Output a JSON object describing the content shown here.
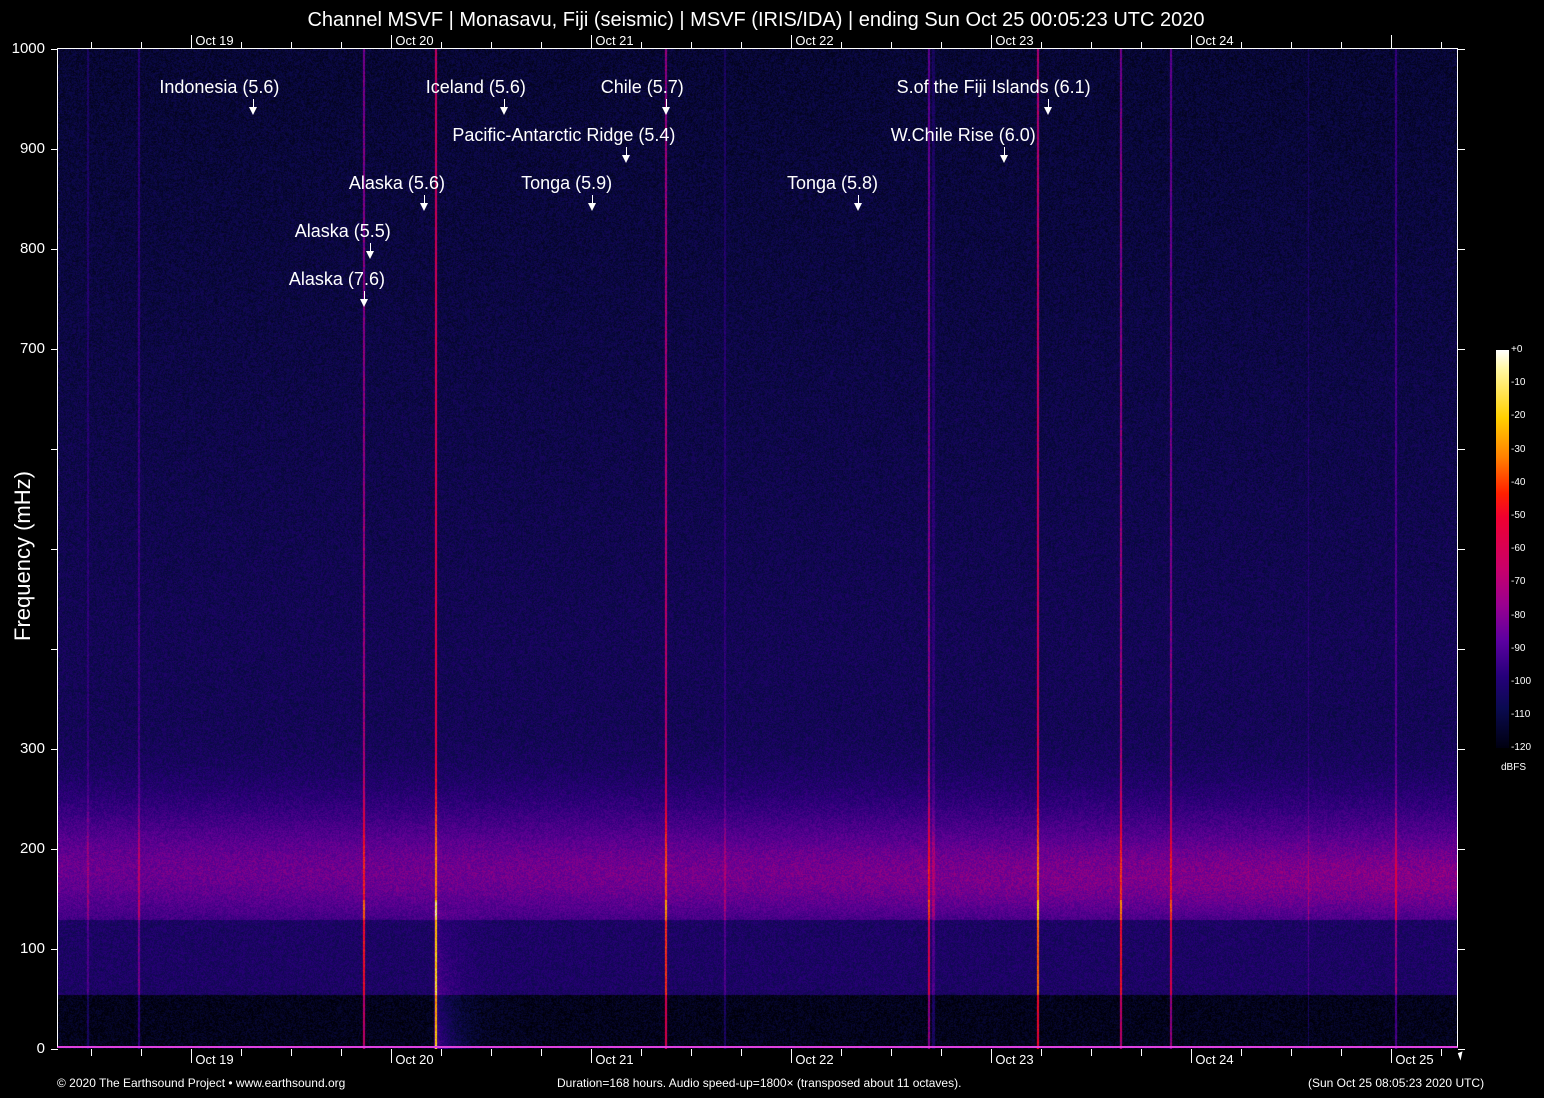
{
  "title": "Channel MSVF | Monasavu, Fiji (seismic) | MSVF (IRIS/IDA) | ending Sun Oct 25 00:05:23 UTC 2020",
  "footer": {
    "copyright": "© 2020 The Earthsound Project • www.earthsound.org",
    "duration": "Duration=168 hours. Audio speed-up=1800× (transposed about 11 octaves).",
    "end_time": "(Sun Oct 25 08:05:23 2020 UTC)"
  },
  "chart_data": {
    "type": "heatmap",
    "title": "Channel MSVF | Monasavu, Fiji (seismic) | MSVF (IRIS/IDA) | ending Sun Oct 25 00:05:23 UTC 2020",
    "ylabel": "Frequency (mHz)",
    "xlabel": "",
    "ylim": [
      0,
      1000
    ],
    "xlim_hours": [
      0,
      168
    ],
    "y_ticks": [
      "0",
      "100",
      "200",
      "300",
      "",
      "",
      "",
      "700",
      "800",
      "900",
      "1000"
    ],
    "x_ticks_top": [
      "Oct 19",
      "Oct 20",
      "Oct 21",
      "Oct 22",
      "Oct 23",
      "Oct 24"
    ],
    "x_ticks_bottom": [
      "Oct 19",
      "Oct 20",
      "Oct 21",
      "Oct 22",
      "Oct 23",
      "Oct 24",
      "Oct 25"
    ],
    "first_day_hour": 16,
    "colorbar": {
      "label": "dBFS",
      "ticks": [
        "+0",
        "-10",
        "-20",
        "-30",
        "-40",
        "-50",
        "-60",
        "-70",
        "-80",
        "-90",
        "-100",
        "-110",
        "-120"
      ],
      "range": [
        -120,
        0
      ]
    },
    "events": [
      {
        "label": "Indonesia (5.6)",
        "hour": 23.4
      },
      {
        "label": "Iceland (5.6)",
        "hour": 53.5
      },
      {
        "label": "Chile (5.7)",
        "hour": 72.9
      },
      {
        "label": "S.of the Fiji Islands (6.1)",
        "hour": 118.8
      },
      {
        "label": "Pacific-Antarctic Ridge (5.4)",
        "hour": 68.2
      },
      {
        "label": "W.Chile Rise (6.0)",
        "hour": 113.5
      },
      {
        "label": "Alaska (5.6)",
        "hour": 43.9
      },
      {
        "label": "Tonga (5.9)",
        "hour": 64.1
      },
      {
        "label": "Tonga (5.8)",
        "hour": 96.0
      },
      {
        "label": "Alaska (5.5)",
        "hour": 37.4
      },
      {
        "label": "Alaska (7.6)",
        "hour": 36.7
      }
    ]
  }
}
